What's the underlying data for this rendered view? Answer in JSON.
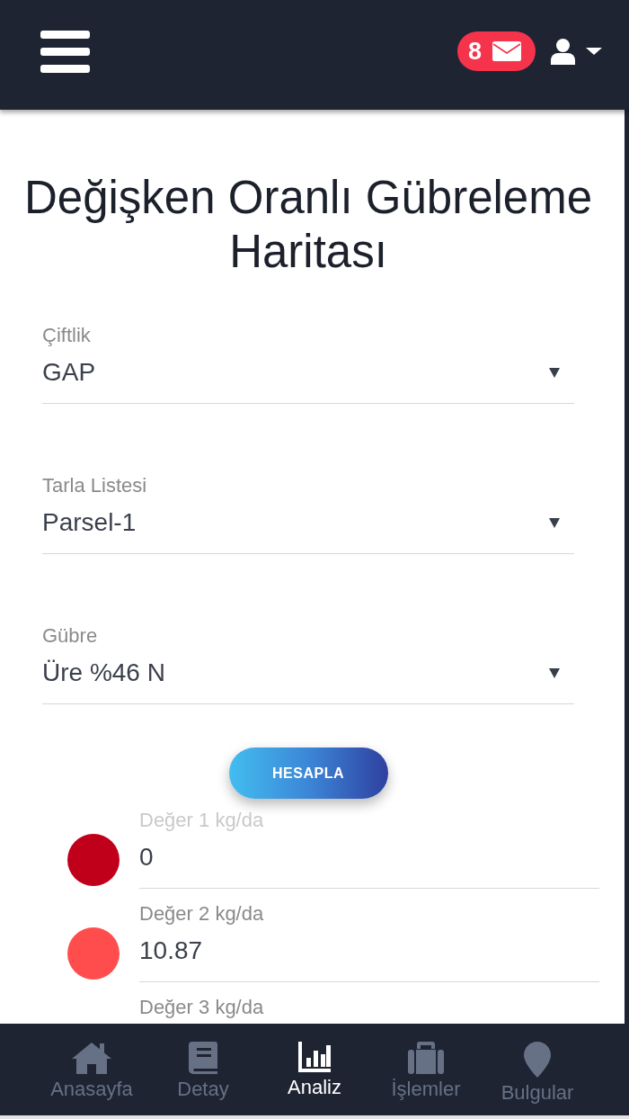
{
  "header": {
    "unread_count": "8"
  },
  "title": "Değişken Oranlı Gübreleme Haritası",
  "fields": [
    {
      "label": "Çiftlik",
      "value": "GAP"
    },
    {
      "label": "Tarla Listesi",
      "value": "Parsel-1"
    },
    {
      "label": "Gübre",
      "value": "Üre %46 N"
    }
  ],
  "button": {
    "label": "HESAPLA"
  },
  "values": [
    {
      "label": "Değer 1 kg/da",
      "value": "0",
      "color": "#c0001a",
      "disabled": true
    },
    {
      "label": "Değer 2 kg/da",
      "value": "10.87",
      "color": "#ff4d4d",
      "disabled": false
    },
    {
      "label": "Değer 3 kg/da",
      "disabled": false
    }
  ],
  "nav": [
    {
      "label": "Anasayfa",
      "selected": false
    },
    {
      "label": "Detay",
      "selected": false
    },
    {
      "label": "Analiz",
      "selected": true
    },
    {
      "label": "İşlemler",
      "selected": false
    },
    {
      "label": "Bulgular",
      "selected": false
    }
  ]
}
